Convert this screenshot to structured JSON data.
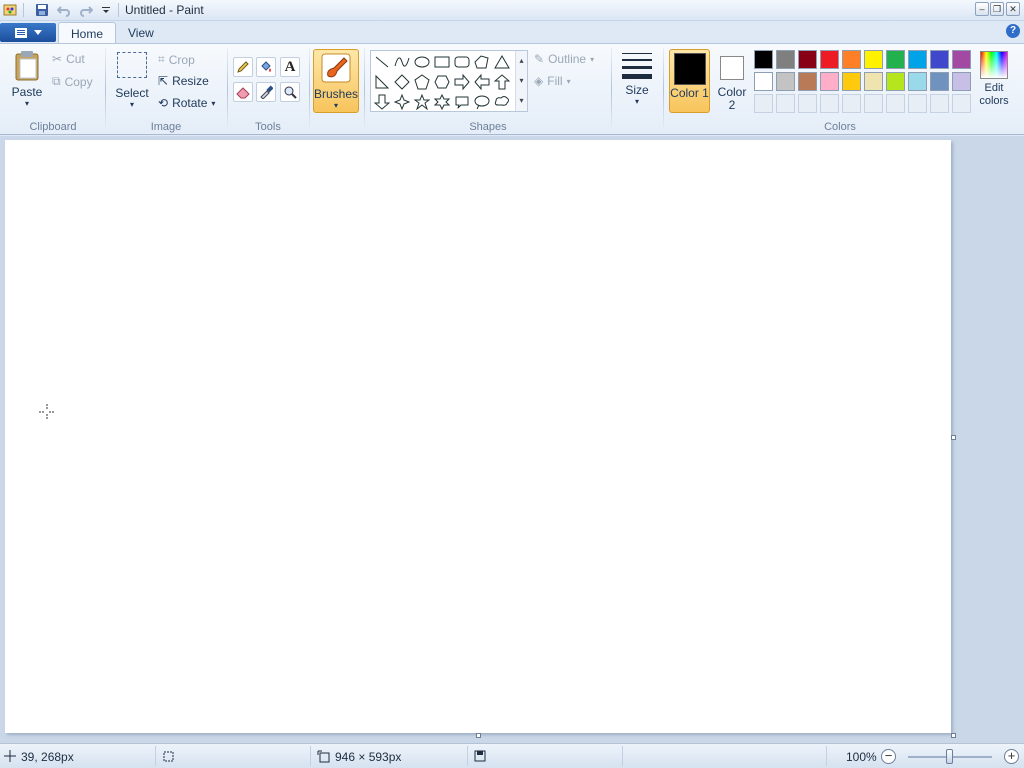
{
  "window": {
    "title": "Untitled - Paint"
  },
  "tabs": [
    {
      "label": "Home",
      "active": true
    },
    {
      "label": "View",
      "active": false
    }
  ],
  "ribbon": {
    "clipboard": {
      "label": "Clipboard",
      "paste": "Paste",
      "cut": "Cut",
      "copy": "Copy"
    },
    "image": {
      "label": "Image",
      "select": "Select",
      "crop": "Crop",
      "resize": "Resize",
      "rotate": "Rotate"
    },
    "tools": {
      "label": "Tools"
    },
    "brushes": {
      "label": "Brushes"
    },
    "shapes": {
      "label": "Shapes",
      "outline": "Outline",
      "fill": "Fill"
    },
    "size": {
      "label": "Size"
    },
    "colors": {
      "label": "Colors",
      "color1": "Color 1",
      "color2": "Color 2",
      "edit": "Edit colors",
      "color1_value": "#000000",
      "color2_value": "#ffffff",
      "palette_row1": [
        "#000000",
        "#7f7f7f",
        "#880015",
        "#ed1c24",
        "#ff7f27",
        "#fff200",
        "#22b14c",
        "#00a2e8",
        "#3f48cc",
        "#a349a4"
      ],
      "palette_row2": [
        "#ffffff",
        "#c3c3c3",
        "#b97a57",
        "#ffaec9",
        "#ffc90e",
        "#efe4b0",
        "#b5e61d",
        "#99d9ea",
        "#7092be",
        "#c8bfe7"
      ]
    }
  },
  "status": {
    "cursor_pos": "39, 268px",
    "canvas_size": "946 × 593px",
    "zoom": "100%",
    "zoom_level": 0.5
  }
}
